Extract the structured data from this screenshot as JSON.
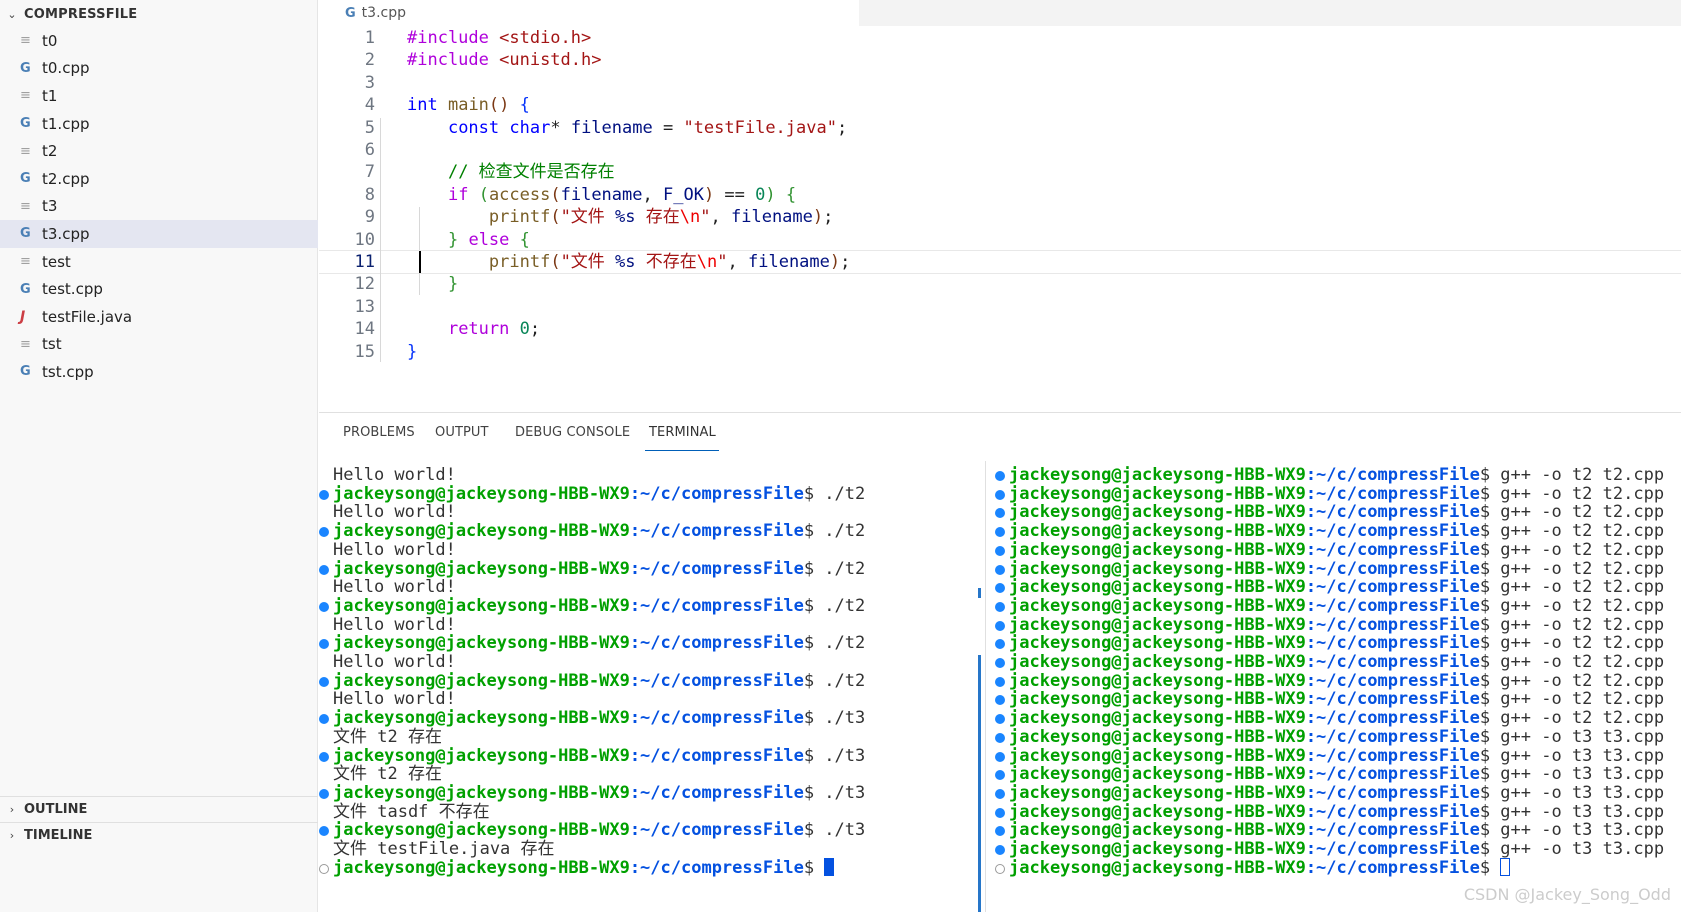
{
  "sidebar": {
    "section_title": "COMPRESSFILE",
    "files": [
      {
        "name": "t0",
        "icon": "text-file-icon"
      },
      {
        "name": "t0.cpp",
        "icon": "cpp-file-icon"
      },
      {
        "name": "t1",
        "icon": "text-file-icon"
      },
      {
        "name": "t1.cpp",
        "icon": "cpp-file-icon"
      },
      {
        "name": "t2",
        "icon": "text-file-icon"
      },
      {
        "name": "t2.cpp",
        "icon": "cpp-file-icon"
      },
      {
        "name": "t3",
        "icon": "text-file-icon"
      },
      {
        "name": "t3.cpp",
        "icon": "cpp-file-icon",
        "selected": true
      },
      {
        "name": "test",
        "icon": "text-file-icon"
      },
      {
        "name": "test.cpp",
        "icon": "cpp-file-icon"
      },
      {
        "name": "testFile.java",
        "icon": "java-file-icon"
      },
      {
        "name": "tst",
        "icon": "text-file-icon"
      },
      {
        "name": "tst.cpp",
        "icon": "cpp-file-icon"
      }
    ],
    "outline_label": "OUTLINE",
    "timeline_label": "TIMELINE"
  },
  "editor": {
    "tab_label": "t3.cpp",
    "active_line": 11,
    "lines": [
      {
        "n": "1",
        "tokens": [
          [
            "pp",
            "#include "
          ],
          [
            "inc",
            "<stdio.h>"
          ]
        ]
      },
      {
        "n": "2",
        "tokens": [
          [
            "pp",
            "#include "
          ],
          [
            "inc",
            "<unistd.h>"
          ]
        ]
      },
      {
        "n": "3",
        "tokens": []
      },
      {
        "n": "4",
        "tokens": [
          [
            "kw",
            "int"
          ],
          [
            "p",
            " "
          ],
          [
            "fn",
            "main"
          ],
          [
            "br3",
            "()"
          ],
          [
            "p",
            " "
          ],
          [
            "br1",
            "{"
          ]
        ]
      },
      {
        "n": "5",
        "tokens": [
          [
            "p",
            "    "
          ],
          [
            "kw",
            "const"
          ],
          [
            "p",
            " "
          ],
          [
            "kw",
            "char"
          ],
          [
            "p",
            "* "
          ],
          [
            "var",
            "filename"
          ],
          [
            "p",
            " = "
          ],
          [
            "str",
            "\"testFile.java\""
          ],
          [
            "p",
            ";"
          ]
        ]
      },
      {
        "n": "6",
        "tokens": []
      },
      {
        "n": "7",
        "tokens": [
          [
            "p",
            "    "
          ],
          [
            "cm",
            "// 检查文件是否存在"
          ]
        ]
      },
      {
        "n": "8",
        "tokens": [
          [
            "p",
            "    "
          ],
          [
            "kwc",
            "if"
          ],
          [
            "p",
            " "
          ],
          [
            "br2",
            "("
          ],
          [
            "fn",
            "access"
          ],
          [
            "br3",
            "("
          ],
          [
            "var",
            "filename"
          ],
          [
            "p",
            ", "
          ],
          [
            "var",
            "F_OK"
          ],
          [
            "br3",
            ")"
          ],
          [
            "p",
            " == "
          ],
          [
            "num",
            "0"
          ],
          [
            "br2",
            ")"
          ],
          [
            "p",
            " "
          ],
          [
            "br2",
            "{"
          ]
        ]
      },
      {
        "n": "9",
        "tokens": [
          [
            "p",
            "        "
          ],
          [
            "fn",
            "printf"
          ],
          [
            "br3",
            "("
          ],
          [
            "str",
            "\"文件 "
          ],
          [
            "fmt",
            "%s"
          ],
          [
            "str",
            " 存在"
          ],
          [
            "esc",
            "\\n"
          ],
          [
            "str",
            "\""
          ],
          [
            "p",
            ", "
          ],
          [
            "var",
            "filename"
          ],
          [
            "br3",
            ")"
          ],
          [
            "p",
            ";"
          ]
        ]
      },
      {
        "n": "10",
        "tokens": [
          [
            "p",
            "    "
          ],
          [
            "br2",
            "}"
          ],
          [
            "p",
            " "
          ],
          [
            "kwc",
            "else"
          ],
          [
            "p",
            " "
          ],
          [
            "br2",
            "{"
          ]
        ]
      },
      {
        "n": "11",
        "tokens": [
          [
            "p",
            "        "
          ],
          [
            "fn",
            "printf"
          ],
          [
            "br3",
            "("
          ],
          [
            "str",
            "\"文件 "
          ],
          [
            "fmt",
            "%s"
          ],
          [
            "str",
            " 不存在"
          ],
          [
            "esc",
            "\\n"
          ],
          [
            "str",
            "\""
          ],
          [
            "p",
            ", "
          ],
          [
            "var",
            "filename"
          ],
          [
            "br3",
            ")"
          ],
          [
            "p",
            ";"
          ]
        ]
      },
      {
        "n": "12",
        "tokens": [
          [
            "p",
            "    "
          ],
          [
            "br2",
            "}"
          ]
        ]
      },
      {
        "n": "13",
        "tokens": []
      },
      {
        "n": "14",
        "tokens": [
          [
            "p",
            "    "
          ],
          [
            "kwc",
            "return"
          ],
          [
            "p",
            " "
          ],
          [
            "num",
            "0"
          ],
          [
            "p",
            ";"
          ]
        ]
      },
      {
        "n": "15",
        "tokens": [
          [
            "br1",
            "}"
          ]
        ]
      }
    ]
  },
  "panel": {
    "tabs": [
      "PROBLEMS",
      "OUTPUT",
      "DEBUG CONSOLE",
      "TERMINAL"
    ],
    "active_tab": "TERMINAL",
    "prompt_user": "jackeysong@jackeysong-HBB-WX9",
    "prompt_path": ":~/c/compressFile",
    "prompt_symbol": "$",
    "left_terminal": [
      {
        "type": "out",
        "text": "Hello world!"
      },
      {
        "type": "prompt",
        "cmd": " ./t2"
      },
      {
        "type": "out",
        "text": "Hello world!"
      },
      {
        "type": "prompt",
        "cmd": " ./t2"
      },
      {
        "type": "out",
        "text": "Hello world!"
      },
      {
        "type": "prompt",
        "cmd": " ./t2"
      },
      {
        "type": "out",
        "text": "Hello world!"
      },
      {
        "type": "prompt",
        "cmd": " ./t2"
      },
      {
        "type": "out",
        "text": "Hello world!"
      },
      {
        "type": "prompt",
        "cmd": " ./t2"
      },
      {
        "type": "out",
        "text": "Hello world!"
      },
      {
        "type": "prompt",
        "cmd": " ./t2"
      },
      {
        "type": "out",
        "text": "Hello world!"
      },
      {
        "type": "prompt",
        "cmd": " ./t3"
      },
      {
        "type": "out",
        "text": "文件 t2 存在"
      },
      {
        "type": "prompt",
        "cmd": " ./t3"
      },
      {
        "type": "out",
        "text": "文件 t2 存在"
      },
      {
        "type": "prompt",
        "cmd": " ./t3"
      },
      {
        "type": "out",
        "text": "文件 tasdf 不存在"
      },
      {
        "type": "prompt",
        "cmd": " ./t3"
      },
      {
        "type": "out",
        "text": "文件 testFile.java 存在"
      },
      {
        "type": "prompt",
        "cmd": " ",
        "cursor": "solid",
        "hollow": true
      }
    ],
    "right_terminal": [
      {
        "type": "prompt",
        "cmd": " g++ -o t2 t2.cpp"
      },
      {
        "type": "prompt",
        "cmd": " g++ -o t2 t2.cpp"
      },
      {
        "type": "prompt",
        "cmd": " g++ -o t2 t2.cpp"
      },
      {
        "type": "prompt",
        "cmd": " g++ -o t2 t2.cpp"
      },
      {
        "type": "prompt",
        "cmd": " g++ -o t2 t2.cpp"
      },
      {
        "type": "prompt",
        "cmd": " g++ -o t2 t2.cpp"
      },
      {
        "type": "prompt",
        "cmd": " g++ -o t2 t2.cpp"
      },
      {
        "type": "prompt",
        "cmd": " g++ -o t2 t2.cpp"
      },
      {
        "type": "prompt",
        "cmd": " g++ -o t2 t2.cpp"
      },
      {
        "type": "prompt",
        "cmd": " g++ -o t2 t2.cpp"
      },
      {
        "type": "prompt",
        "cmd": " g++ -o t2 t2.cpp"
      },
      {
        "type": "prompt",
        "cmd": " g++ -o t2 t2.cpp"
      },
      {
        "type": "prompt",
        "cmd": " g++ -o t2 t2.cpp"
      },
      {
        "type": "prompt",
        "cmd": " g++ -o t2 t2.cpp"
      },
      {
        "type": "prompt",
        "cmd": " g++ -o t3 t3.cpp"
      },
      {
        "type": "prompt",
        "cmd": " g++ -o t3 t3.cpp"
      },
      {
        "type": "prompt",
        "cmd": " g++ -o t3 t3.cpp"
      },
      {
        "type": "prompt",
        "cmd": " g++ -o t3 t3.cpp"
      },
      {
        "type": "prompt",
        "cmd": " g++ -o t3 t3.cpp"
      },
      {
        "type": "prompt",
        "cmd": " g++ -o t3 t3.cpp"
      },
      {
        "type": "prompt",
        "cmd": " g++ -o t3 t3.cpp"
      },
      {
        "type": "prompt",
        "cmd": " ",
        "cursor": "outline",
        "hollow": true
      }
    ],
    "watermark": "CSDN @Jackey_Song_Odd"
  },
  "colors": {
    "accent": "#005fb8",
    "prompt_user": "#00a000",
    "prompt_path": "#0451e0",
    "dot": "#1a85ff",
    "selection": "#e4e6f1"
  }
}
